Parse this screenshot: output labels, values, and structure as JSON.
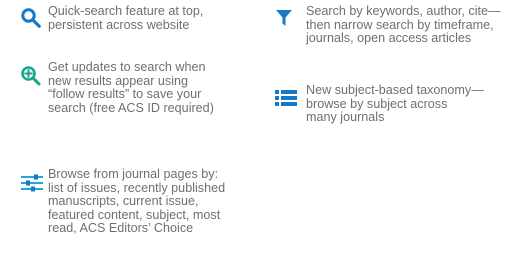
{
  "features": [
    {
      "icon": "search-icon",
      "text": "Quick-search feature at top,\npersistent across website"
    },
    {
      "icon": "zoom-plus-icon",
      "text": "Get updates to search when\nnew results appear using\n“follow results” to save your\nsearch (free ACS ID required)"
    },
    {
      "icon": "sliders-icon",
      "text": "Browse from journal pages by:\nlist of issues, recently published\nmanuscripts, current issue,\nfeatured content, subject, most\nread, ACS Editors’ Choice"
    },
    {
      "icon": "filter-icon",
      "text": "Search by keywords, author, cite—\nthen narrow search by timeframe,\njournals, open access articles"
    },
    {
      "icon": "list-icon",
      "text": "New subject-based taxonomy—\nbrowse by subject across\nmany journals"
    }
  ],
  "colors": {
    "accent": "#1778c8",
    "accent_alt": "#22a4df",
    "text": "#6f6f6f"
  }
}
